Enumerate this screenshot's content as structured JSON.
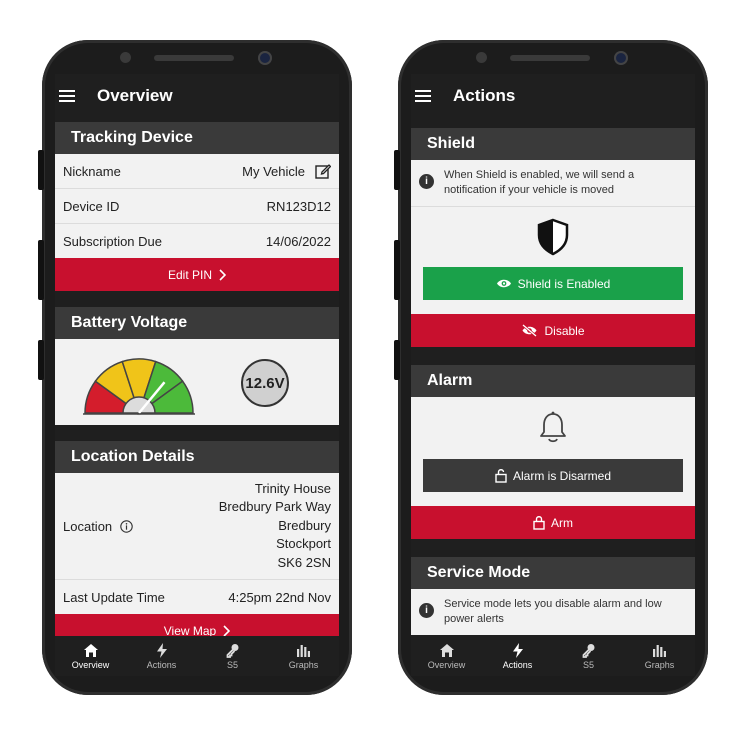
{
  "overview": {
    "title": "Overview",
    "tracking": {
      "header": "Tracking Device",
      "nickname_label": "Nickname",
      "nickname_value": "My Vehicle",
      "device_label": "Device ID",
      "device_value": "RN123D12",
      "subscription_label": "Subscription Due",
      "subscription_value": "14/06/2022",
      "edit_pin": "Edit PIN"
    },
    "battery": {
      "header": "Battery Voltage",
      "value": "12.6V",
      "gauge_level": 0.72
    },
    "location": {
      "header": "Location Details",
      "label": "Location",
      "address": [
        "Trinity House",
        "Bredbury Park Way",
        "Bredbury",
        "Stockport",
        "SK6 2SN"
      ],
      "last_update_label": "Last Update Time",
      "last_update_value": "4:25pm 22nd Nov",
      "view_map": "View Map"
    }
  },
  "actions": {
    "title": "Actions",
    "shield": {
      "header": "Shield",
      "info": "When Shield is enabled, we will send a notification if your vehicle is moved",
      "status": "Shield is Enabled",
      "disable": "Disable"
    },
    "alarm": {
      "header": "Alarm",
      "status": "Alarm is Disarmed",
      "arm": "Arm"
    },
    "service": {
      "header": "Service Mode",
      "info": "Service mode lets you disable alarm and low power alerts"
    }
  },
  "nav": {
    "overview": "Overview",
    "actions": "Actions",
    "s5": "S5",
    "graphs": "Graphs"
  },
  "colors": {
    "red": "#c8102e",
    "green": "#1aa14a",
    "header": "#3a3a3a"
  }
}
